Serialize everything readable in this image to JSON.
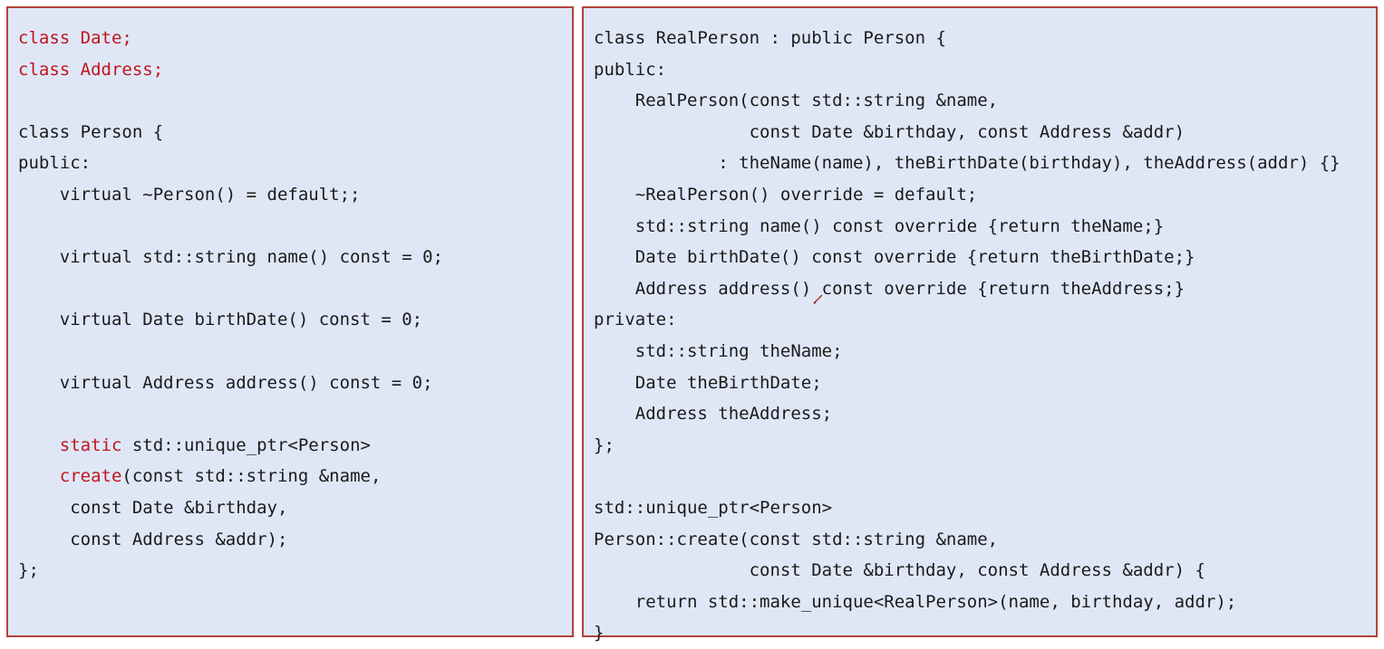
{
  "colors": {
    "panel_background": "#dfe7f7",
    "panel_border": "#b5413a",
    "keyword_red": "#c0161b",
    "text": "#1a1a1a"
  },
  "left_panel": {
    "lines": [
      [
        {
          "text": "class Date;",
          "color": "red"
        }
      ],
      [
        {
          "text": "class Address;",
          "color": "red"
        }
      ],
      [],
      [
        {
          "text": "class Person {"
        }
      ],
      [
        {
          "text": "public:"
        }
      ],
      [
        {
          "text": "    virtual ~Person() = default;;"
        }
      ],
      [],
      [
        {
          "text": "    virtual std::string name() const = 0;"
        }
      ],
      [],
      [
        {
          "text": "    virtual Date birthDate() const = 0;"
        }
      ],
      [],
      [
        {
          "text": "    virtual Address address() const = 0;"
        }
      ],
      [],
      [
        {
          "text": "    "
        },
        {
          "text": "static",
          "color": "red"
        },
        {
          "text": " std::unique_ptr<Person>"
        }
      ],
      [
        {
          "text": "    "
        },
        {
          "text": "create",
          "color": "red"
        },
        {
          "text": "(const std::string &name,"
        }
      ],
      [
        {
          "text": "     const Date &birthday,"
        }
      ],
      [
        {
          "text": "     const Address &addr);"
        }
      ],
      [
        {
          "text": "};"
        }
      ]
    ]
  },
  "right_panel": {
    "lines": [
      [
        {
          "text": "class RealPerson : public Person {"
        }
      ],
      [
        {
          "text": "public:"
        }
      ],
      [
        {
          "text": "    RealPerson(const std::string &name,"
        }
      ],
      [
        {
          "text": "               const Date &birthday, const Address &addr)"
        }
      ],
      [
        {
          "text": "            : theName(name), theBirthDate(birthday), theAddress(addr) {}"
        }
      ],
      [
        {
          "text": "    ~RealPerson() override = default;"
        }
      ],
      [
        {
          "text": "    std::string name() const override {return theName;}"
        }
      ],
      [
        {
          "text": "    Date birthDate() const override {return theBirthDate;}"
        }
      ],
      [
        {
          "text": "    Address address() const override {return theAddress;}"
        }
      ],
      [
        {
          "text": "private:"
        }
      ],
      [
        {
          "text": "    std::string theName;"
        }
      ],
      [
        {
          "text": "    Date theBirthDate;"
        }
      ],
      [
        {
          "text": "    Address theAddress;"
        }
      ],
      [
        {
          "text": "};"
        }
      ],
      [],
      [
        {
          "text": "std::unique_ptr<Person>"
        }
      ],
      [
        {
          "text": "Person::create(const std::string &name,"
        }
      ],
      [
        {
          "text": "               const Date &birthday, const Address &addr) {"
        }
      ],
      [
        {
          "text": "    return std::make_unique<RealPerson>(name, birthday, addr);"
        }
      ],
      [
        {
          "text": "}"
        }
      ]
    ]
  }
}
